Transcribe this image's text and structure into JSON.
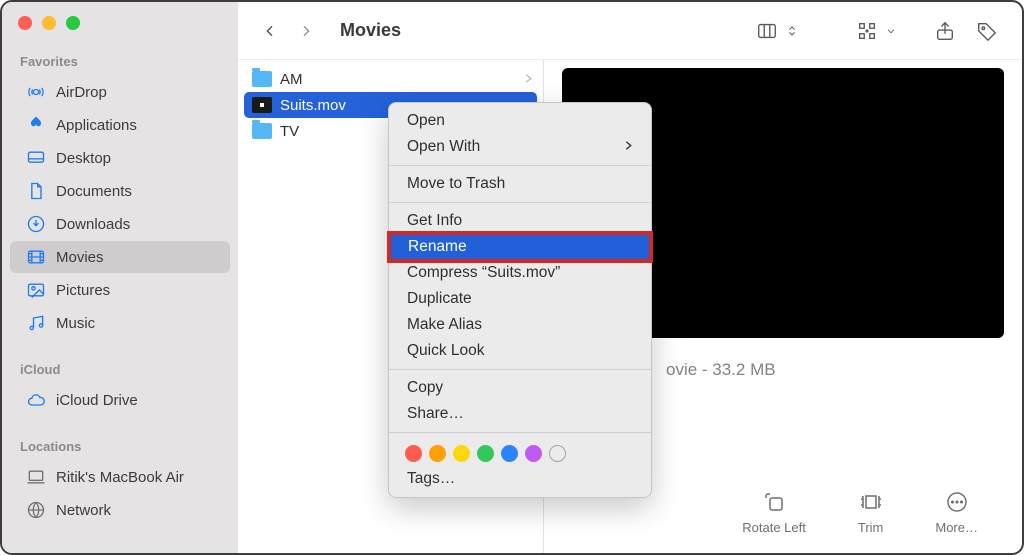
{
  "window": {
    "title": "Movies"
  },
  "sidebar": {
    "sections": [
      {
        "header": "Favorites",
        "items": [
          {
            "label": "AirDrop",
            "icon": "airdrop-icon"
          },
          {
            "label": "Applications",
            "icon": "applications-icon"
          },
          {
            "label": "Desktop",
            "icon": "desktop-icon"
          },
          {
            "label": "Documents",
            "icon": "documents-icon"
          },
          {
            "label": "Downloads",
            "icon": "downloads-icon"
          },
          {
            "label": "Movies",
            "icon": "movies-icon",
            "active": true
          },
          {
            "label": "Pictures",
            "icon": "pictures-icon"
          },
          {
            "label": "Music",
            "icon": "music-icon"
          }
        ]
      },
      {
        "header": "iCloud",
        "items": [
          {
            "label": "iCloud Drive",
            "icon": "icloud-icon"
          }
        ]
      },
      {
        "header": "Locations",
        "items": [
          {
            "label": "Ritik's MacBook Air",
            "icon": "laptop-icon",
            "grey": true
          },
          {
            "label": "Network",
            "icon": "network-icon",
            "grey": true
          }
        ]
      }
    ]
  },
  "column_list": {
    "items": [
      {
        "name": "AM",
        "type": "folder"
      },
      {
        "name": "Suits.mov",
        "type": "mov",
        "selected": true
      },
      {
        "name": "TV",
        "type": "folder"
      }
    ]
  },
  "preview": {
    "meta_suffix": "ovie - 33.2 MB",
    "actions": [
      {
        "label": "Rotate Left",
        "icon": "rotate-left-icon"
      },
      {
        "label": "Trim",
        "icon": "trim-icon"
      },
      {
        "label": "More…",
        "icon": "more-icon"
      }
    ]
  },
  "context_menu": {
    "items": [
      {
        "label": "Open"
      },
      {
        "label": "Open With",
        "submenu": true
      },
      {
        "sep": true
      },
      {
        "label": "Move to Trash"
      },
      {
        "sep": true
      },
      {
        "label": "Get Info"
      },
      {
        "label": "Rename",
        "highlighted": true,
        "boxed": true
      },
      {
        "label": "Compress “Suits.mov”"
      },
      {
        "label": "Duplicate"
      },
      {
        "label": "Make Alias"
      },
      {
        "label": "Quick Look"
      },
      {
        "sep": true
      },
      {
        "label": "Copy"
      },
      {
        "label": "Share…"
      },
      {
        "sep": true
      },
      {
        "tags": true
      },
      {
        "label": "Tags…"
      }
    ],
    "tag_colors": [
      "#ff5b4e",
      "#ff9f0a",
      "#ffd60a",
      "#34c759",
      "#2a84ff",
      "#bf5af2"
    ]
  },
  "toolbar": {
    "view_switch": "columns",
    "group_by": "grid"
  }
}
